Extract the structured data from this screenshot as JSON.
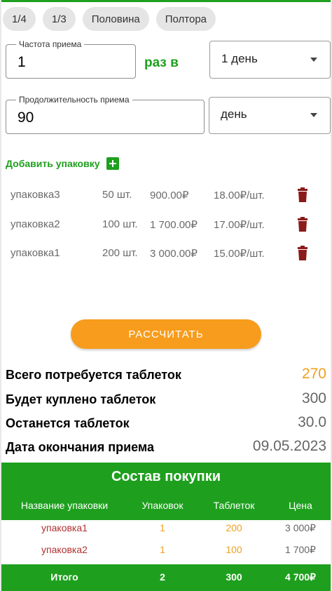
{
  "quick_chips": [
    "1/4",
    "1/3",
    "Половина",
    "Полтора"
  ],
  "frequency": {
    "label": "Частота приема",
    "value": "1",
    "connector": "раз в",
    "period_select": "1 день"
  },
  "duration": {
    "label": "Продолжительность приема",
    "value": "90",
    "unit_select": "день"
  },
  "add_package_label": "Добавить упаковку",
  "packages": [
    {
      "name": "упаковка3",
      "qty": "50 шт.",
      "price": "900.00₽",
      "unit_price": "18.00₽/шт."
    },
    {
      "name": "упаковка2",
      "qty": "100 шт.",
      "price": "1 700.00₽",
      "unit_price": "17.00₽/шт."
    },
    {
      "name": "упаковка1",
      "qty": "200 шт.",
      "price": "3 000.00₽",
      "unit_price": "15.00₽/шт."
    }
  ],
  "calculate_button": "РАССЧИТАТЬ",
  "summary": [
    {
      "label": "Всего потребуется таблеток",
      "value": "270"
    },
    {
      "label": "Будет куплено таблеток",
      "value": "300"
    },
    {
      "label": "Останется таблеток",
      "value": "30.0"
    },
    {
      "label": "Дата окончания приема",
      "value": "09.05.2023"
    }
  ],
  "purchase": {
    "title": "Состав покупки",
    "headers": [
      "Название упаковки",
      "Упаковок",
      "Таблеток",
      "Цена"
    ],
    "rows": [
      {
        "name": "упаковка1",
        "packs": "1",
        "tablets": "200",
        "price": "3 000₽"
      },
      {
        "name": "упаковка2",
        "packs": "1",
        "tablets": "100",
        "price": "1 700₽"
      }
    ],
    "total": {
      "label": "Итого",
      "packs": "2",
      "tablets": "300",
      "price": "4 700₽"
    }
  },
  "colors": {
    "accent_green": "#1ea01e",
    "accent_orange": "#f79c1c",
    "trash_red": "#8b1a1a"
  },
  "icons": {
    "add": "plus-square-icon",
    "delete": "trash-icon",
    "dropdown": "chevron-down-icon"
  }
}
